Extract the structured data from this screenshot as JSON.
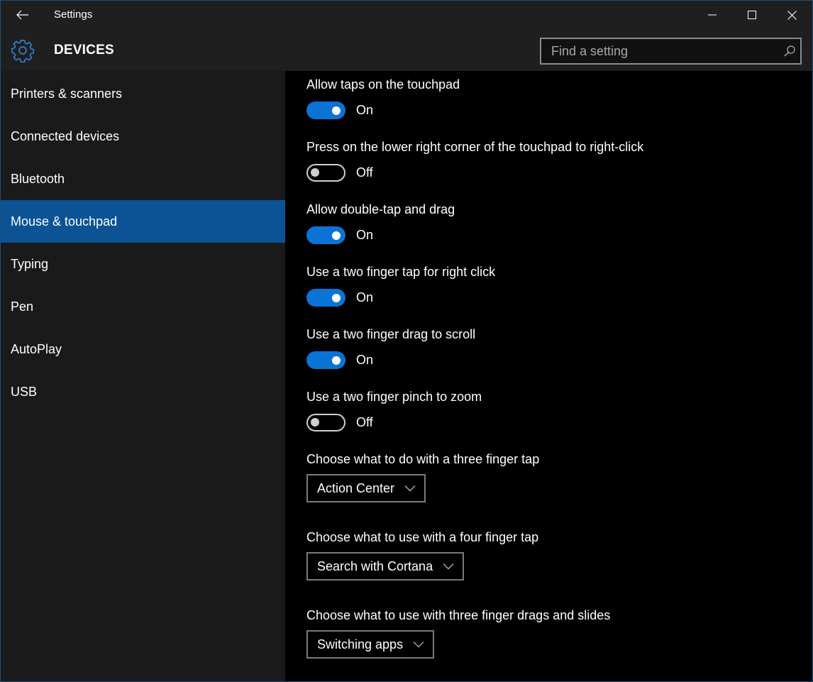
{
  "window": {
    "title": "Settings",
    "border_color": "#1f4e79",
    "controls": {
      "minimize": "minimize",
      "maximize": "maximize",
      "close": "close"
    }
  },
  "header": {
    "section_title": "DEVICES",
    "icon": "gear-icon",
    "search": {
      "placeholder": "Find a setting",
      "value": ""
    }
  },
  "sidebar": {
    "items": [
      {
        "label": "Printers & scanners",
        "active": false
      },
      {
        "label": "Connected devices",
        "active": false
      },
      {
        "label": "Bluetooth",
        "active": false
      },
      {
        "label": "Mouse & touchpad",
        "active": true
      },
      {
        "label": "Typing",
        "active": false
      },
      {
        "label": "Pen",
        "active": false
      },
      {
        "label": "AutoPlay",
        "active": false
      },
      {
        "label": "USB",
        "active": false
      }
    ],
    "active_color": "#0b5394"
  },
  "settings": {
    "toggles": [
      {
        "label": "Allow taps on the touchpad",
        "on": true,
        "state_label": "On"
      },
      {
        "label": "Press on the lower right corner of the touchpad to right-click",
        "on": false,
        "state_label": "Off"
      },
      {
        "label": "Allow double-tap and drag",
        "on": true,
        "state_label": "On"
      },
      {
        "label": "Use a two finger tap for right click",
        "on": true,
        "state_label": "On"
      },
      {
        "label": "Use a two finger drag to scroll",
        "on": true,
        "state_label": "On"
      },
      {
        "label": "Use a two finger pinch to zoom",
        "on": false,
        "state_label": "Off"
      }
    ],
    "dropdowns": [
      {
        "label": "Choose what to do with a three finger tap",
        "value": "Action Center"
      },
      {
        "label": "Choose what to use with a four finger tap",
        "value": "Search with Cortana"
      },
      {
        "label": "Choose what to use with three finger drags and slides",
        "value": "Switching apps"
      }
    ],
    "accent_color": "#0a74d6"
  }
}
